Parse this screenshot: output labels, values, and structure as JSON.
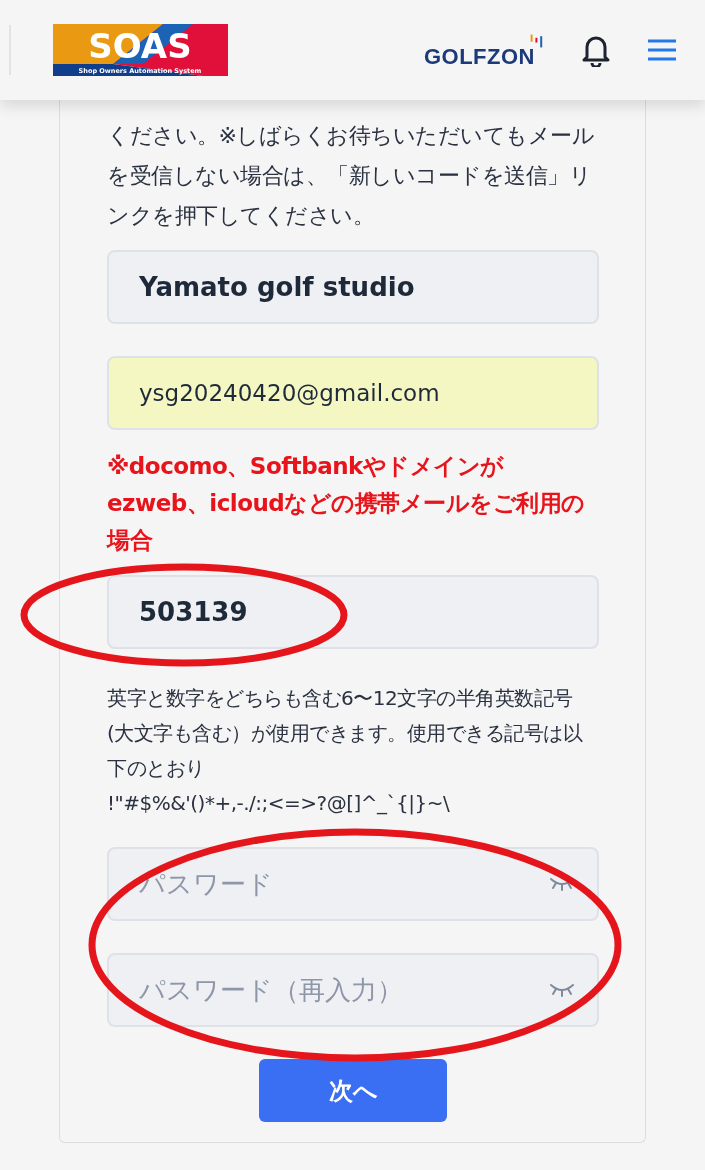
{
  "header": {
    "logo": {
      "title": "SOAS",
      "subtitle": "Shop Owners Automation System"
    },
    "brand": "GOLFZON"
  },
  "instructions": "ください。※しばらくお待ちいただいてもメールを受信しない場合は、「新しいコードを送信」リンクを押下してください。",
  "form": [
    {
      "kind": "field",
      "value": "Yamato golf studio",
      "autofilled": false,
      "circled": false
    },
    {
      "kind": "field",
      "value": "ysg20240420@gmail.com",
      "autofilled": true,
      "circled": false
    },
    {
      "kind": "warning",
      "text": "※docomo、Softbankやドメインがezweb、icloudなどの携帯メールをご利用の場合"
    },
    {
      "kind": "field",
      "value": "503139",
      "autofilled": false,
      "circled": true
    },
    {
      "kind": "hint",
      "text": "英字と数字をどちらも含む6〜12文字の半角英数記号(大文字も含む）が使用できます。使用できる記号は以下のとおり"
    },
    {
      "kind": "hint",
      "text": "!\"#$%&'()*+,-./:;<=>?@[]^_`{|}~\\"
    },
    {
      "kind": "password",
      "placeholder": "パスワード",
      "circled": true
    },
    {
      "kind": "password",
      "placeholder": "パスワード（再入力）",
      "circled": true
    }
  ],
  "submit": {
    "label": "次へ"
  }
}
